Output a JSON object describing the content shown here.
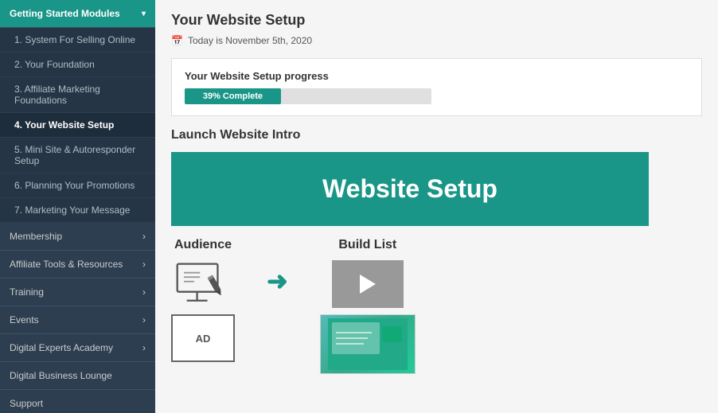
{
  "sidebar": {
    "getting_started_label": "Getting Started Modules",
    "items": [
      {
        "id": "item-1",
        "label": "1. System For Selling Online",
        "active": false
      },
      {
        "id": "item-2",
        "label": "2. Your Foundation",
        "active": false
      },
      {
        "id": "item-3",
        "label": "3. Affiliate Marketing Foundations",
        "active": false
      },
      {
        "id": "item-4",
        "label": "4. Your Website Setup",
        "active": true
      },
      {
        "id": "item-5",
        "label": "5. Mini Site & Autoresponder Setup",
        "active": false
      },
      {
        "id": "item-6",
        "label": "6. Planning Your Promotions",
        "active": false
      },
      {
        "id": "item-7",
        "label": "7. Marketing Your Message",
        "active": false
      }
    ],
    "sections": [
      {
        "id": "membership",
        "label": "Membership"
      },
      {
        "id": "affiliate-tools",
        "label": "Affiliate Tools & Resources"
      },
      {
        "id": "training",
        "label": "Training"
      },
      {
        "id": "events",
        "label": "Events"
      },
      {
        "id": "digital-experts",
        "label": "Digital Experts Academy"
      },
      {
        "id": "digital-business",
        "label": "Digital Business Lounge"
      },
      {
        "id": "support",
        "label": "Support"
      }
    ]
  },
  "main": {
    "page_title": "Your Website Setup",
    "date_label": "Today is November 5th, 2020",
    "progress_label": "Your Website Setup progress",
    "progress_percent": 39,
    "progress_text": "39% Complete",
    "section_title": "Launch Website Intro",
    "video_title": "Website Setup",
    "audience_label": "Audience",
    "build_list_label": "Build List"
  },
  "icons": {
    "calendar": "📅",
    "chevron_down": "▾",
    "chevron_right": "›",
    "play": "▶",
    "arrow_right": "→"
  },
  "colors": {
    "teal": "#1a9688",
    "sidebar_dark": "#2c3e50",
    "sidebar_mid": "#253545"
  }
}
